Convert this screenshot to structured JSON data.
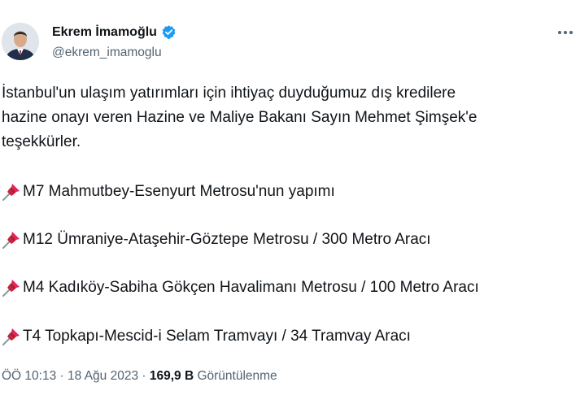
{
  "author": {
    "name": "Ekrem İmamoğlu",
    "handle": "@ekrem_imamoglu",
    "verified": true
  },
  "tweet": {
    "intro_lines": [
      "İstanbul'un ulaşım yatırımları için ihtiyaç duyduğumuz dış kredilere",
      "hazine onayı veren Hazine ve Maliye Bakanı Sayın Mehmet Şimşek'e",
      "teşekkürler."
    ],
    "items": [
      {
        "icon": "pushpin-icon",
        "text": "M7 Mahmutbey-Esenyurt Metrosu'nun yapımı"
      },
      {
        "icon": "pushpin-icon",
        "text": "M12 Ümraniye-Ataşehir-Göztepe Metrosu / 300 Metro Aracı"
      },
      {
        "icon": "pushpin-icon",
        "text": "M4 Kadıköy-Sabiha Gökçen Havalimanı Metrosu / 100 Metro Aracı"
      },
      {
        "icon": "pushpin-icon",
        "text": "T4 Topkapı-Mescid-i Selam Tramvayı / 34 Tramvay Aracı"
      }
    ]
  },
  "meta": {
    "time": "ÖÖ 10:13",
    "separator": " · ",
    "date": "18 Ağu 2023",
    "views_count": "169,9 B",
    "views_label": "Görüntülenme"
  },
  "colors": {
    "text": "#0f1419",
    "secondary": "#536471",
    "verified": "#1d9bf0",
    "pin": "#e0245e"
  }
}
